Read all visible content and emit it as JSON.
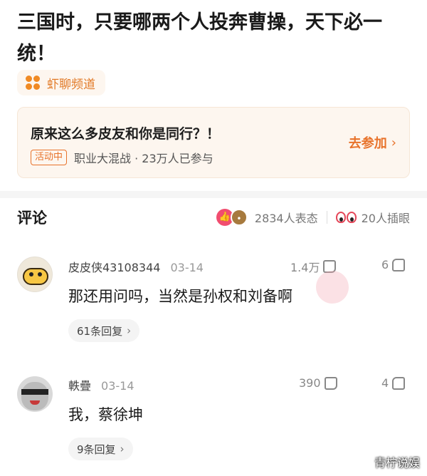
{
  "article": {
    "title": "三国时，只要哪两个人投奔曹操，天下必一统！"
  },
  "channel": {
    "icon": "shrimp-channel-icon",
    "label": "虾聊频道",
    "accent": "#e27a27"
  },
  "event": {
    "title": "原来这么多皮友和你是同行？！",
    "badge": "活动中",
    "subtitle": "职业大混战 · 23万人已参与",
    "join_label": "去参加",
    "join_chevron": "›"
  },
  "comments_section": {
    "title": "评论",
    "reaction_count": "2834人表态",
    "insert_eye_count": "20人插眼"
  },
  "comments": [
    {
      "user": "皮皮侠43108344",
      "date": "03-14",
      "likes": "1.4万",
      "dislikes": "6",
      "text": "那还用问吗，当然是孙权和刘备啊",
      "replies": "61条回复",
      "chevron": "›"
    },
    {
      "user": "軼疊",
      "date": "03-14",
      "likes": "390",
      "dislikes": "4",
      "text": "我，蔡徐坤",
      "replies": "9条回复",
      "chevron": "›"
    }
  ],
  "watermark": "青柠说娱"
}
